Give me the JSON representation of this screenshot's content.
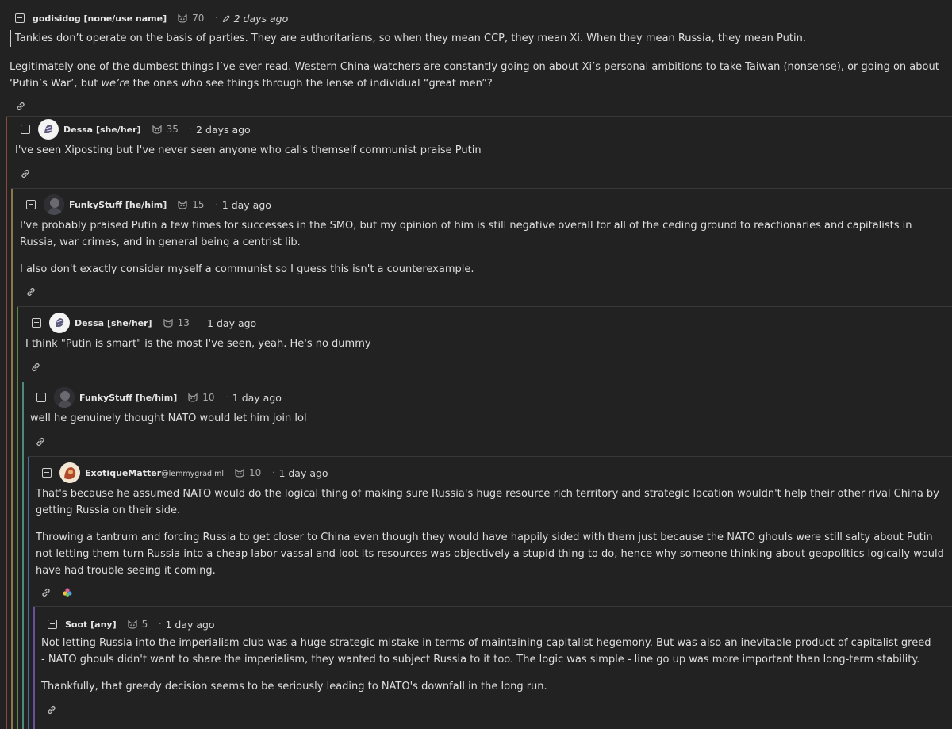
{
  "comments": [
    {
      "user": "godisidog [none/use name]",
      "instance": "",
      "score": "70",
      "time": "2 days ago",
      "edited": true,
      "paragraphs": {
        "quote": "Tankies don’t operate on the basis of parties. They are authoritarians, so when they mean CCP, they mean Xi. When they mean Russia, they mean Putin.",
        "p1": "Legitimately one of the dumbest things I’ve ever read. Western China-watchers are constantly going on about Xi’s personal ambitions to take Taiwan (nonsense), or going on about ‘Putin’s War’, but",
        "p1_em": "we’re",
        "p1_tail": " the ones who see things through the lense of individual “great men”?"
      }
    },
    {
      "user": "Dessa [she/her]",
      "instance": "",
      "score": "35",
      "time": "2 days ago",
      "paragraphs": {
        "p1": "I've seen Xiposting but I've never seen anyone who calls themself communist praise Putin"
      }
    },
    {
      "user": "FunkyStuff [he/him]",
      "instance": "",
      "score": "15",
      "time": "1 day ago",
      "paragraphs": {
        "p1": "I've probably praised Putin a few times for successes in the SMO, but my opinion of him is still negative overall for all of the ceding ground to reactionaries and capitalists in Russia, war crimes, and in general being a centrist lib.",
        "p2": "I also don't exactly consider myself a communist so I guess this isn't a counterexample."
      }
    },
    {
      "user": "Dessa [she/her]",
      "instance": "",
      "score": "13",
      "time": "1 day ago",
      "paragraphs": {
        "p1": "I think \"Putin is smart\" is the most I've seen, yeah. He's no dummy"
      }
    },
    {
      "user": "FunkyStuff [he/him]",
      "instance": "",
      "score": "10",
      "time": "1 day ago",
      "paragraphs": {
        "p1": "well he genuinely thought NATO would let him join lol"
      }
    },
    {
      "user": "ExotiqueMatter",
      "instance": "@lemmygrad.ml",
      "score": "10",
      "time": "1 day ago",
      "paragraphs": {
        "p1": "That's because he assumed NATO would do the logical thing of making sure Russia's huge resource rich territory and strategic location wouldn't help their other rival China by getting Russia on their side.",
        "p2": "Throwing a tantrum and forcing Russia to get closer to China even though they would have happily sided with them just because the NATO ghouls were still salty about Putin not letting them turn Russia into a cheap labor vassal and loot its resources was objectively a stupid thing to do, hence why someone thinking about geopolitics logically would have had trouble seeing it coming."
      }
    },
    {
      "user": "Soot [any]",
      "instance": "",
      "score": "5",
      "time": "1 day ago",
      "paragraphs": {
        "p1": "Not letting Russia into the imperialism club was a huge strategic mistake in terms of maintaining capitalist hegemony. But was also an inevitable product of capitalist greed - NATO ghouls didn't want to share the imperialism, they wanted to subject Russia to it too. The logic was simple - line go up was more important than long-term stability.",
        "p2": "Thankfully, that greedy decision seems to be seriously leading to NATO's downfall in the long run."
      }
    }
  ],
  "colors": {
    "background": "#222222",
    "thread_bars": [
      "#8c4a40",
      "#8a7a45",
      "#5d8a4c",
      "#4d8a7a",
      "#4a6e9a",
      "#6a4f9a"
    ]
  },
  "icons": [
    "collapse-icon",
    "upvote-cat-icon",
    "pencil-icon",
    "link-icon",
    "emoji-reaction-icon"
  ]
}
